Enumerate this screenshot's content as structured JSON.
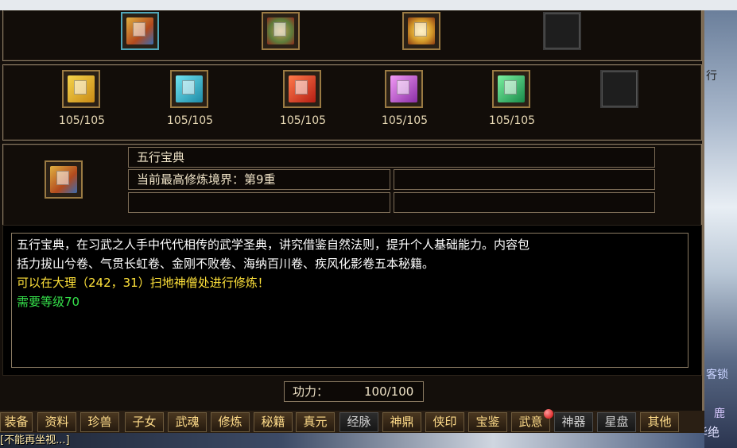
{
  "top_slots": [
    {
      "icon": "five-elements-book-icon",
      "color": "#c98a2c",
      "selected": true
    },
    {
      "icon": "scroll-bundle-icon",
      "color": "#6f8f45"
    },
    {
      "icon": "golden-chest-icon",
      "color": "#d49a2a"
    },
    {
      "icon": "empty-slot",
      "empty": true
    }
  ],
  "books": [
    {
      "icon": "yellow-book-icon",
      "color": "#e5b52a",
      "count": "105/105"
    },
    {
      "icon": "cyan-book-icon",
      "color": "#2fb5c9",
      "count": "105/105"
    },
    {
      "icon": "red-book-icon",
      "color": "#d83d2a",
      "count": "105/105"
    },
    {
      "icon": "purple-book-icon",
      "color": "#c04fd0",
      "count": "105/105"
    },
    {
      "icon": "green-book-icon",
      "color": "#27b56a",
      "count": "105/105"
    },
    {
      "icon": "empty-slot",
      "empty": true
    }
  ],
  "info": {
    "name": "五行宝典",
    "realm": "当前最高修炼境界：第9重"
  },
  "description": {
    "line1": "五行宝典，在习武之人手中代代相传的武学圣典，讲究借鉴自然法则，提升个人基础能力。内容包",
    "line2": "括力拔山兮卷、气贯长虹卷、金刚不败卷、海纳百川卷、疾风化影卷五本秘籍。",
    "location": "可以在大理（242，31）扫地神僧处进行修炼！",
    "requirement": "需要等级70"
  },
  "power": {
    "label": "功力：",
    "value": "100/100"
  },
  "tabs": [
    "装备",
    "资料",
    "珍兽",
    "子女",
    "武魂",
    "修炼",
    "秘籍",
    "真元",
    "经脉",
    "神鼎",
    "侠印",
    "宝鉴",
    "武意",
    "神器",
    "星盘",
    "其他"
  ],
  "chat": "[不能再坐视...]",
  "scene_text": {
    "a": "行",
    "b": "客锁",
    "c": "鹿",
    "d": "风华绝"
  }
}
